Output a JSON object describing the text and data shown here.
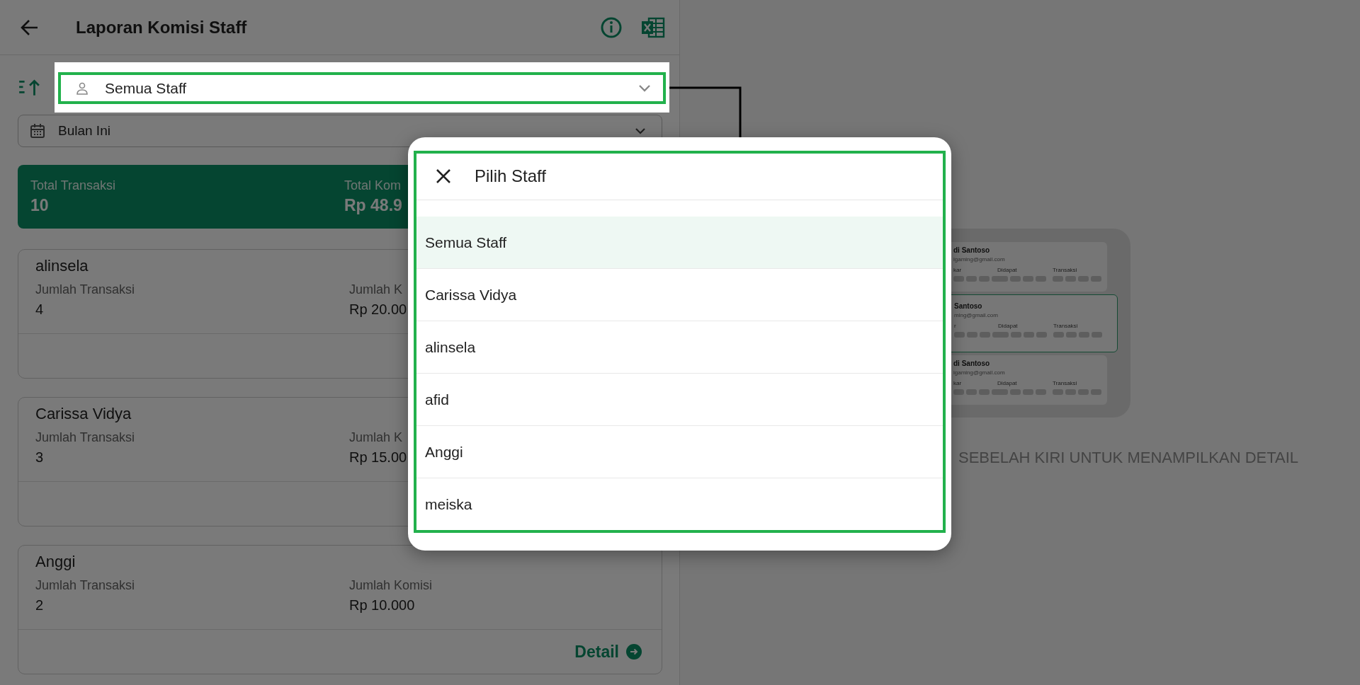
{
  "header": {
    "title": "Laporan Komisi Staff"
  },
  "filters": {
    "staff": "Semua Staff",
    "period": "Bulan Ini"
  },
  "summary": [
    {
      "label": "Total Transaksi",
      "value": "10"
    },
    {
      "label": "Total Kom",
      "value": "Rp 48.9"
    }
  ],
  "staff_cards": [
    {
      "name": "alinsela",
      "columns": [
        {
          "label": "Jumlah Transaksi",
          "value": "4"
        },
        {
          "label": "Jumlah K",
          "value": "Rp 20.00"
        }
      ]
    },
    {
      "name": "Carissa Vidya",
      "columns": [
        {
          "label": "Jumlah Transaksi",
          "value": "3"
        },
        {
          "label": "Jumlah K",
          "value": "Rp 15.00"
        }
      ]
    },
    {
      "name": "Anggi",
      "columns": [
        {
          "label": "Jumlah Transaksi",
          "value": "2"
        },
        {
          "label": "Jumlah Komisi",
          "value": "Rp 10.000"
        }
      ],
      "link": "Detail"
    }
  ],
  "empty_state": {
    "illustration_cards": [
      {
        "name": "di Santoso",
        "email": "igaming@gmail.com",
        "columns": [
          "kar",
          "Didapat",
          "Transaksi"
        ],
        "highlighted": false
      },
      {
        "name": "Santoso",
        "email": "ming@gmail.com",
        "columns": [
          "r",
          "Didapat",
          "Transaksi"
        ],
        "highlighted": true
      },
      {
        "name": "di Santoso",
        "email": "igaming@gmail.com",
        "columns": [
          "kar",
          "Didapat",
          "Transaksi"
        ],
        "highlighted": false
      }
    ],
    "message": "SEBELAH KIRI UNTUK MENAMPILKAN DETAIL"
  },
  "staff_picker": {
    "title": "Pilih Staff",
    "options": [
      {
        "label": "Semua Staff",
        "selected": true
      },
      {
        "label": "Carissa Vidya",
        "selected": false
      },
      {
        "label": "alinsela",
        "selected": false
      },
      {
        "label": "afid",
        "selected": false
      },
      {
        "label": "Anggi",
        "selected": false
      },
      {
        "label": "meiska",
        "selected": false
      }
    ]
  }
}
